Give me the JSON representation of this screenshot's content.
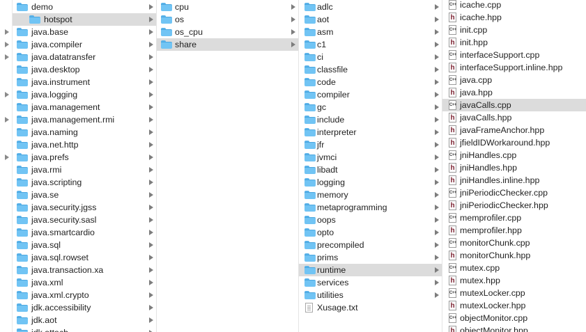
{
  "column1": {
    "items": [
      {
        "label": "demo",
        "expandable": false,
        "selected": false
      },
      {
        "label": "hotspot",
        "expandable": false,
        "selected": true
      },
      {
        "label": "java.base",
        "expandable": true,
        "selected": false
      },
      {
        "label": "java.compiler",
        "expandable": true,
        "selected": false
      },
      {
        "label": "java.datatransfer",
        "expandable": true,
        "selected": false
      },
      {
        "label": "java.desktop",
        "expandable": false,
        "selected": false
      },
      {
        "label": "java.instrument",
        "expandable": false,
        "selected": false
      },
      {
        "label": "java.logging",
        "expandable": true,
        "selected": false
      },
      {
        "label": "java.management",
        "expandable": false,
        "selected": false
      },
      {
        "label": "java.management.rmi",
        "expandable": true,
        "selected": false
      },
      {
        "label": "java.naming",
        "expandable": false,
        "selected": false
      },
      {
        "label": "java.net.http",
        "expandable": false,
        "selected": false
      },
      {
        "label": "java.prefs",
        "expandable": true,
        "selected": false
      },
      {
        "label": "java.rmi",
        "expandable": false,
        "selected": false
      },
      {
        "label": "java.scripting",
        "expandable": false,
        "selected": false
      },
      {
        "label": "java.se",
        "expandable": false,
        "selected": false
      },
      {
        "label": "java.security.jgss",
        "expandable": false,
        "selected": false
      },
      {
        "label": "java.security.sasl",
        "expandable": false,
        "selected": false
      },
      {
        "label": "java.smartcardio",
        "expandable": false,
        "selected": false
      },
      {
        "label": "java.sql",
        "expandable": false,
        "selected": false
      },
      {
        "label": "java.sql.rowset",
        "expandable": false,
        "selected": false
      },
      {
        "label": "java.transaction.xa",
        "expandable": false,
        "selected": false
      },
      {
        "label": "java.xml",
        "expandable": false,
        "selected": false
      },
      {
        "label": "java.xml.crypto",
        "expandable": false,
        "selected": false
      },
      {
        "label": "jdk.accessibility",
        "expandable": false,
        "selected": false
      },
      {
        "label": "jdk.aot",
        "expandable": false,
        "selected": false
      },
      {
        "label": "jdk.attach",
        "expandable": false,
        "selected": false
      }
    ]
  },
  "column2": {
    "items": [
      {
        "label": "cpu",
        "selected": false
      },
      {
        "label": "os",
        "selected": false
      },
      {
        "label": "os_cpu",
        "selected": false
      },
      {
        "label": "share",
        "selected": true
      }
    ]
  },
  "column3": {
    "items": [
      {
        "label": "adlc",
        "type": "folder",
        "selected": false
      },
      {
        "label": "aot",
        "type": "folder",
        "selected": false
      },
      {
        "label": "asm",
        "type": "folder",
        "selected": false
      },
      {
        "label": "c1",
        "type": "folder",
        "selected": false
      },
      {
        "label": "ci",
        "type": "folder",
        "selected": false
      },
      {
        "label": "classfile",
        "type": "folder",
        "selected": false
      },
      {
        "label": "code",
        "type": "folder",
        "selected": false
      },
      {
        "label": "compiler",
        "type": "folder",
        "selected": false
      },
      {
        "label": "gc",
        "type": "folder",
        "selected": false
      },
      {
        "label": "include",
        "type": "folder",
        "selected": false
      },
      {
        "label": "interpreter",
        "type": "folder",
        "selected": false
      },
      {
        "label": "jfr",
        "type": "folder",
        "selected": false
      },
      {
        "label": "jvmci",
        "type": "folder",
        "selected": false
      },
      {
        "label": "libadt",
        "type": "folder",
        "selected": false
      },
      {
        "label": "logging",
        "type": "folder",
        "selected": false
      },
      {
        "label": "memory",
        "type": "folder",
        "selected": false
      },
      {
        "label": "metaprogramming",
        "type": "folder",
        "selected": false
      },
      {
        "label": "oops",
        "type": "folder",
        "selected": false
      },
      {
        "label": "opto",
        "type": "folder",
        "selected": false
      },
      {
        "label": "precompiled",
        "type": "folder",
        "selected": false
      },
      {
        "label": "prims",
        "type": "folder",
        "selected": false
      },
      {
        "label": "runtime",
        "type": "folder",
        "selected": true
      },
      {
        "label": "services",
        "type": "folder",
        "selected": false
      },
      {
        "label": "utilities",
        "type": "folder",
        "selected": false
      },
      {
        "label": "Xusage.txt",
        "type": "text",
        "selected": false
      }
    ]
  },
  "column4": {
    "items": [
      {
        "label": "icache.cpp",
        "kind": "cpp",
        "selected": false
      },
      {
        "label": "icache.hpp",
        "kind": "hpp",
        "selected": false
      },
      {
        "label": "init.cpp",
        "kind": "cpp",
        "selected": false
      },
      {
        "label": "init.hpp",
        "kind": "hpp",
        "selected": false
      },
      {
        "label": "interfaceSupport.cpp",
        "kind": "cpp",
        "selected": false
      },
      {
        "label": "interfaceSupport.inline.hpp",
        "kind": "hpp",
        "selected": false
      },
      {
        "label": "java.cpp",
        "kind": "cpp",
        "selected": false
      },
      {
        "label": "java.hpp",
        "kind": "hpp",
        "selected": false
      },
      {
        "label": "javaCalls.cpp",
        "kind": "cpp",
        "selected": true
      },
      {
        "label": "javaCalls.hpp",
        "kind": "hpp",
        "selected": false
      },
      {
        "label": "javaFrameAnchor.hpp",
        "kind": "hpp",
        "selected": false
      },
      {
        "label": "jfieldIDWorkaround.hpp",
        "kind": "hpp",
        "selected": false
      },
      {
        "label": "jniHandles.cpp",
        "kind": "cpp",
        "selected": false
      },
      {
        "label": "jniHandles.hpp",
        "kind": "hpp",
        "selected": false
      },
      {
        "label": "jniHandles.inline.hpp",
        "kind": "hpp",
        "selected": false
      },
      {
        "label": "jniPeriodicChecker.cpp",
        "kind": "cpp",
        "selected": false
      },
      {
        "label": "jniPeriodicChecker.hpp",
        "kind": "hpp",
        "selected": false
      },
      {
        "label": "memprofiler.cpp",
        "kind": "cpp",
        "selected": false
      },
      {
        "label": "memprofiler.hpp",
        "kind": "hpp",
        "selected": false
      },
      {
        "label": "monitorChunk.cpp",
        "kind": "cpp",
        "selected": false
      },
      {
        "label": "monitorChunk.hpp",
        "kind": "hpp",
        "selected": false
      },
      {
        "label": "mutex.cpp",
        "kind": "cpp",
        "selected": false
      },
      {
        "label": "mutex.hpp",
        "kind": "hpp",
        "selected": false
      },
      {
        "label": "mutexLocker.cpp",
        "kind": "cpp",
        "selected": false
      },
      {
        "label": "mutexLocker.hpp",
        "kind": "hpp",
        "selected": false
      },
      {
        "label": "objectMonitor.cpp",
        "kind": "cpp",
        "selected": false
      },
      {
        "label": "objectMonitor.hpp",
        "kind": "hpp",
        "selected": false
      }
    ]
  },
  "icons": {
    "folder": "folder-icon",
    "text_file": "text-file-icon",
    "cpp_file": "cpp-file-icon",
    "hpp_file": "hpp-file-icon",
    "cpp_badge": "C++",
    "hpp_badge": "h"
  },
  "colors": {
    "folder": "#71c4f4",
    "selection": "#dcdcdc",
    "header_glyph": "#7a2130"
  }
}
